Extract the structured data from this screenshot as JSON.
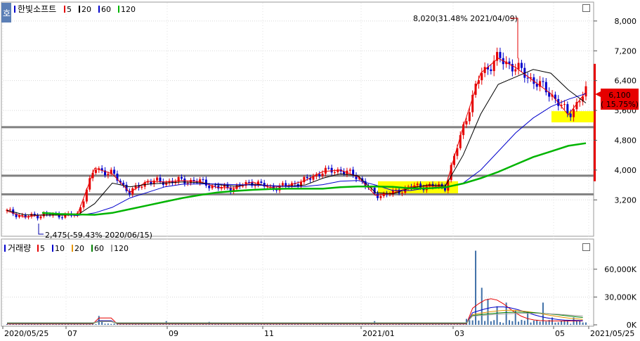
{
  "price_panel": {
    "badge": "호",
    "title": "한빛소프트",
    "ma_legend": [
      {
        "label": "5",
        "color": "#e60000"
      },
      {
        "label": "20",
        "color": "#000000"
      },
      {
        "label": "60",
        "color": "#0000cc"
      },
      {
        "label": "120",
        "color": "#00b400"
      }
    ],
    "high_annotation": "8,020(31.48% 2021/04/09)",
    "low_annotation": "2,475(-59.43% 2020/06/15)",
    "last_price": "6,100",
    "last_change": "( 15.75%)",
    "support_lines": [
      5150,
      3850,
      3350
    ]
  },
  "volume_panel": {
    "title": "거래량",
    "ma_legend": [
      {
        "label": "5",
        "color": "#e60000"
      },
      {
        "label": "10",
        "color": "#0000cc"
      },
      {
        "label": "20",
        "color": "#e69500"
      },
      {
        "label": "60",
        "color": "#008000"
      },
      {
        "label": "120",
        "color": "#999999"
      }
    ]
  },
  "colors": {
    "up": "#e60000",
    "down": "#0000cc",
    "highlight": "#ffff00",
    "badge": "#5b7fb6",
    "support": "#808080"
  },
  "chart_data": [
    {
      "type": "candlestick",
      "title": "한빛소프트",
      "y_ticks": [
        3200,
        4000,
        4800,
        5600,
        6400,
        7200,
        8000
      ],
      "y_tick_labels": [
        "3,200",
        "4,000",
        "4,800",
        "5,600",
        "6,400",
        "7,200",
        "8,000"
      ],
      "ylim": [
        2300,
        8450
      ],
      "series": [
        {
          "name": "5",
          "values": [
            2900,
            2740,
            2800,
            2790,
            2790,
            4050,
            3900,
            3400,
            3700,
            3680,
            3720,
            3690,
            3530,
            3520,
            3680,
            3530,
            3580,
            3720,
            3960,
            4000,
            3820,
            3320,
            3380,
            3550,
            3570,
            3550,
            5150,
            6600,
            7000,
            6750,
            6400,
            6050,
            5480,
            6100
          ]
        },
        {
          "name": "20",
          "values": [
            2920,
            2800,
            2790,
            2795,
            2790,
            3100,
            3650,
            3550,
            3620,
            3650,
            3680,
            3660,
            3610,
            3570,
            3620,
            3580,
            3565,
            3600,
            3780,
            3900,
            3850,
            3400,
            3360,
            3520,
            3600,
            3580,
            4400,
            5500,
            6300,
            6500,
            6700,
            6600,
            6150,
            5800
          ]
        },
        {
          "name": "60",
          "values": [
            null,
            null,
            null,
            2820,
            2780,
            2850,
            3000,
            3250,
            3400,
            3550,
            3620,
            3630,
            3625,
            3610,
            3600,
            3580,
            3560,
            3560,
            3610,
            3700,
            3720,
            3600,
            3450,
            3450,
            3520,
            3520,
            3650,
            4000,
            4500,
            5000,
            5400,
            5700,
            5900,
            6050
          ]
        },
        {
          "name": "120",
          "values": [
            null,
            null,
            2850,
            2820,
            2810,
            2800,
            2850,
            2950,
            3050,
            3150,
            3250,
            3330,
            3400,
            3440,
            3470,
            3490,
            3500,
            3500,
            3500,
            3540,
            3560,
            3560,
            3550,
            3510,
            3510,
            3540,
            3640,
            3780,
            3950,
            4150,
            4350,
            4500,
            4650,
            4720
          ]
        }
      ]
    },
    {
      "type": "bar",
      "title": "거래량",
      "y_ticks": [
        0,
        30000,
        60000
      ],
      "y_tick_labels": [
        "0K",
        "30,000K",
        "60,000K"
      ],
      "ylim": [
        0,
        88000
      ],
      "peak_value": 80000
    }
  ],
  "x_axis": {
    "labels": [
      "2020/05/25",
      "07",
      "09",
      "11",
      "2021/01",
      "03",
      "05",
      "2021/05/25"
    ]
  }
}
